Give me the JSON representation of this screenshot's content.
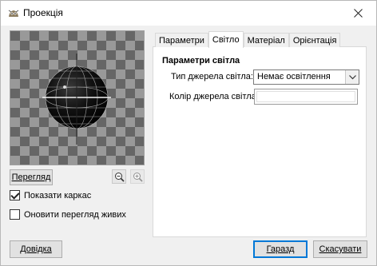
{
  "window": {
    "title": "Проекція",
    "app_icon": "gimp-icon",
    "close_icon": "close-icon"
  },
  "preview": {
    "image": "wireframe-sphere-on-checkerboard",
    "button_label": "Перегляд",
    "zoom_out_icon": "zoom-out-icon",
    "zoom_in_icon": "zoom-in-icon"
  },
  "options": {
    "show_wireframe_label": "Показати каркас",
    "show_wireframe_checked": true,
    "live_update_label": "Оновити перегляд живих",
    "live_update_checked": false
  },
  "tabs": [
    {
      "label": "Параметри",
      "active": false
    },
    {
      "label": "Світло",
      "active": true
    },
    {
      "label": "Матеріал",
      "active": false
    },
    {
      "label": "Орієнтація",
      "active": false
    }
  ],
  "light": {
    "group_title": "Параметри світла",
    "type_label": "Тип джерела світла:",
    "type_value": "Немає освітлення",
    "color_label": "Колір джерела світла:",
    "color_value": "#ffffff"
  },
  "footer": {
    "help_label": "Довідка",
    "ok_label": "Гаразд",
    "cancel_label": "Скасувати"
  }
}
